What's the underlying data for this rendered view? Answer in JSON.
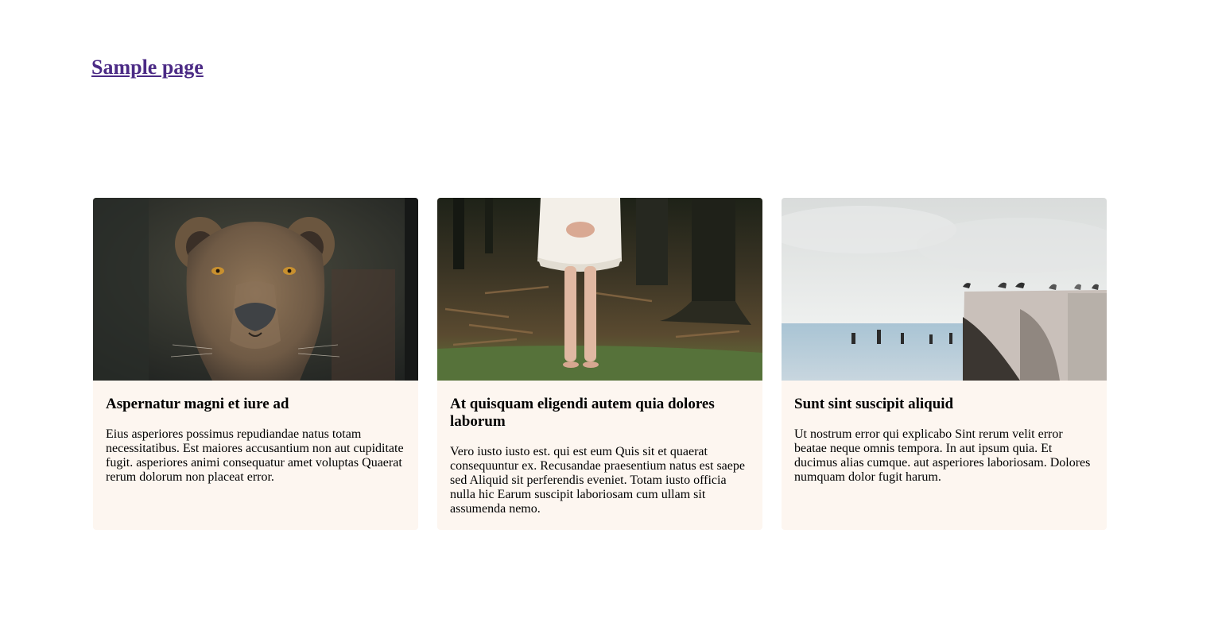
{
  "header": {
    "site_title": "Sample page"
  },
  "cards": [
    {
      "image_subject": "lioness",
      "title": "Aspernatur magni et iure ad",
      "text": "Eius asperiores possimus repudiandae natus totam necessitatibus. Est maiores accusantium non aut cupiditate fugit. asperiores animi consequatur amet voluptas Quaerat rerum dolorum non placeat error."
    },
    {
      "image_subject": "girl-in-white-dress-forest",
      "title": "At quisquam eligendi autem quia dolores laborum",
      "text": "Vero iusto iusto est. qui est eum Quis sit et quaerat consequuntur ex. Recusandae praesentium natus est saepe sed Aliquid sit perferendis eveniet. Totam iusto officia nulla hic Earum suscipit laboriosam cum ullam sit assumenda nemo."
    },
    {
      "image_subject": "seagulls-on-pier-sea",
      "title": "Sunt sint suscipit aliquid",
      "text": "Ut nostrum error qui explicabo Sint rerum velit error beatae neque omnis tempora. In aut ipsum quia. Et ducimus alias cumque. aut asperiores laboriosam. Dolores numquam dolor fugit harum."
    }
  ],
  "colors": {
    "link": "#4b2a85",
    "card_background": "#fdf6f0"
  }
}
